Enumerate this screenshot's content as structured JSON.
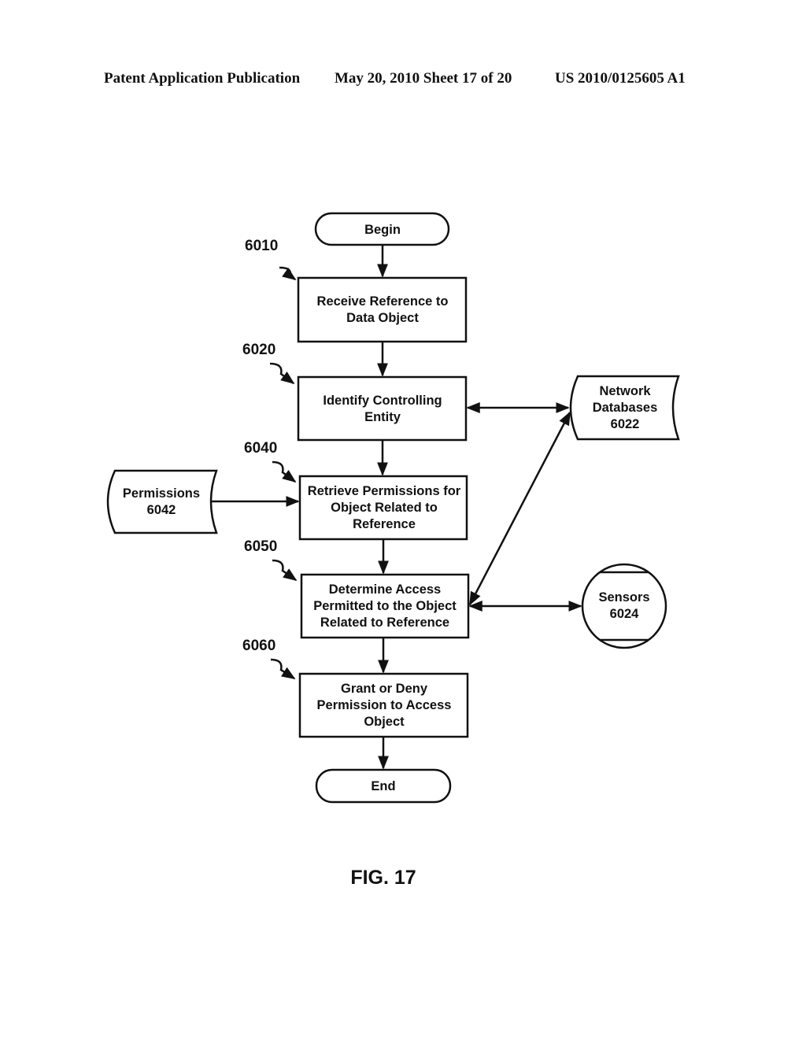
{
  "header": {
    "publication": "Patent Application Publication",
    "date_sheet": "May 20, 2010  Sheet 17 of 20",
    "patent_number": "US 2010/0125605 A1"
  },
  "figure": {
    "caption": "FIG. 17",
    "nodes": {
      "begin": {
        "lines": [
          "Begin"
        ]
      },
      "step_6010": {
        "ref": "6010",
        "lines": [
          "Receive Reference to",
          "Data Object"
        ]
      },
      "step_6020": {
        "ref": "6020",
        "lines": [
          "Identify Controlling",
          "Entity"
        ]
      },
      "step_6040": {
        "ref": "6040",
        "lines": [
          "Retrieve Permissions for",
          "Object Related to",
          "Reference"
        ]
      },
      "step_6050": {
        "ref": "6050",
        "lines": [
          "Determine Access",
          "Permitted to the Object",
          "Related to Reference"
        ]
      },
      "step_6060": {
        "ref": "6060",
        "lines": [
          "Grant or Deny",
          "Permission to Access",
          "Object"
        ]
      },
      "end": {
        "lines": [
          "End"
        ]
      },
      "network_databases": {
        "lines": [
          "Network",
          "Databases",
          "6022"
        ]
      },
      "permissions": {
        "lines": [
          "Permissions",
          "6042"
        ]
      },
      "sensors": {
        "lines": [
          "Sensors",
          "6024"
        ]
      }
    },
    "edges": [
      {
        "from": "begin",
        "to": "step_6010",
        "direction": "forward"
      },
      {
        "from": "step_6010",
        "to": "step_6020",
        "direction": "forward"
      },
      {
        "from": "step_6020",
        "to": "step_6040",
        "direction": "forward"
      },
      {
        "from": "step_6040",
        "to": "step_6050",
        "direction": "forward"
      },
      {
        "from": "step_6050",
        "to": "step_6060",
        "direction": "forward"
      },
      {
        "from": "step_6060",
        "to": "end",
        "direction": "forward"
      },
      {
        "from": "permissions",
        "to": "step_6040",
        "direction": "forward"
      },
      {
        "from": "step_6020",
        "to": "network_databases",
        "direction": "bidirectional"
      },
      {
        "from": "step_6050",
        "to": "network_databases",
        "direction": "bidirectional"
      },
      {
        "from": "step_6050",
        "to": "sensors",
        "direction": "bidirectional"
      }
    ]
  }
}
